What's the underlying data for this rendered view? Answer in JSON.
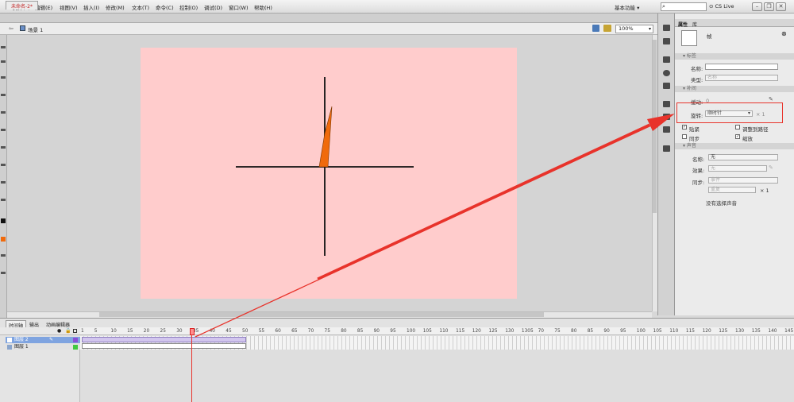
{
  "menus": [
    "文件(F)",
    "编辑(E)",
    "视图(V)",
    "插入(I)",
    "修改(M)",
    "文本(T)",
    "命令(C)",
    "控制(O)",
    "调试(D)",
    "窗口(W)",
    "帮助(H)"
  ],
  "workspace": {
    "label": "基本功能 ▾",
    "cslive": "CS Live"
  },
  "window_buttons": {
    "min": "–",
    "restore": "❐",
    "close": "✕"
  },
  "document": {
    "tab_title": "未命名-2*",
    "scene": "场景 1",
    "zoom": "100%"
  },
  "properties": {
    "tabs": [
      "属性",
      "库"
    ],
    "symbol_name": "帧",
    "sections": {
      "label": "标签",
      "tween": "补间",
      "sound": "声音"
    },
    "label_name": "名称:",
    "label_type": "类型:",
    "label_type_value": "名称",
    "ease_label": "缓动:",
    "ease_value": "0",
    "rotate_label": "旋转:",
    "rotate_value": "顺时针",
    "rotate_times": "× 1",
    "checks": [
      {
        "label": "贴紧",
        "checked": true
      },
      {
        "label": "调整到路径",
        "checked": false
      },
      {
        "label": "同步",
        "checked": false
      },
      {
        "label": "缩放",
        "checked": true
      }
    ],
    "sound_name_label": "名称:",
    "sound_name_value": "无",
    "effect_label": "效果:",
    "effect_value": "无",
    "sync_label": "同步:",
    "sync_value": "事件",
    "repeat_value": "重复",
    "repeat_times": "× 1",
    "no_sound": "没有选择声音"
  },
  "timeline": {
    "tabs": [
      "时间轴",
      "输出",
      "动画编辑器"
    ],
    "ruler": [
      "1",
      "5",
      "10",
      "15",
      "20",
      "25",
      "30",
      "35",
      "40",
      "45",
      "50",
      "55",
      "60",
      "65",
      "70",
      "75",
      "80",
      "85",
      "90",
      "95",
      "100",
      "105",
      "110",
      "115",
      "120",
      "125",
      "130",
      "1305",
      "70",
      "75",
      "80",
      "85",
      "90",
      "95",
      "100",
      "105",
      "110",
      "115",
      "120",
      "125",
      "130",
      "135",
      "140",
      "145",
      "70",
      "75"
    ],
    "layers": [
      {
        "name": "图层 2",
        "selected": true
      },
      {
        "name": "图层 1",
        "selected": false
      }
    ]
  },
  "colors": {
    "stage": "#ffcccc",
    "annotation": "#e8332b",
    "shape": "#f06a0c"
  }
}
